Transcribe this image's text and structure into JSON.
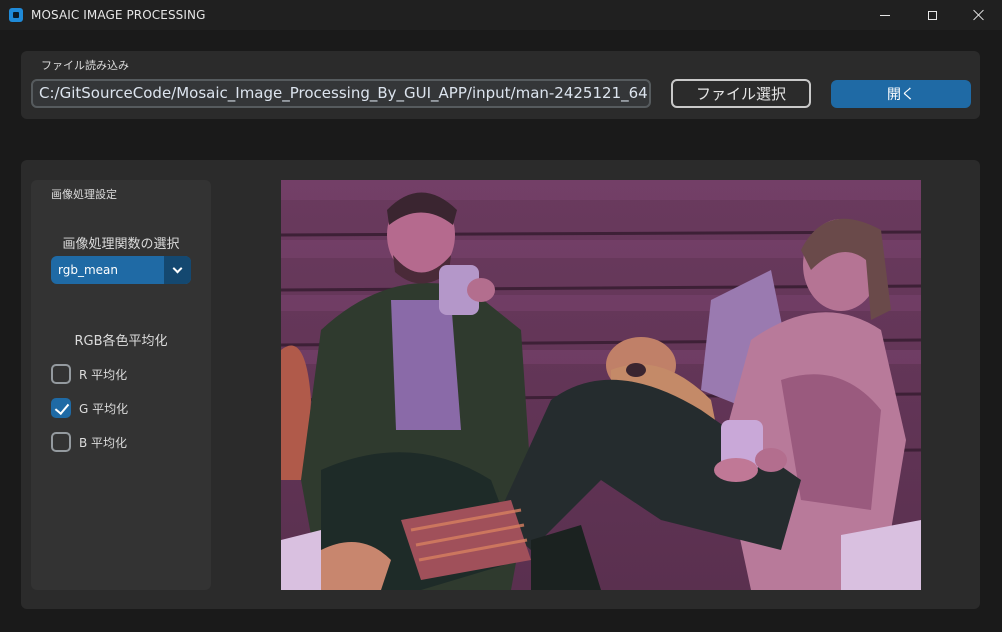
{
  "window": {
    "title": "MOSAIC IMAGE PROCESSING"
  },
  "file_section": {
    "label": "ファイル読み込み",
    "path_value": "C:/GitSourceCode/Mosaic_Image_Processing_By_GUI_APP/input/man-2425121_64",
    "select_button": "ファイル選択",
    "open_button": "開く"
  },
  "settings": {
    "label": "画像処理設定",
    "function_label": "画像処理関数の選択",
    "function_value": "rgb_mean",
    "rgb_label": "RGB各色平均化",
    "checkboxes": [
      {
        "label": "R 平均化",
        "checked": false
      },
      {
        "label": "G 平均化",
        "checked": true
      },
      {
        "label": "B 平均化",
        "checked": false
      }
    ]
  },
  "colors": {
    "accent": "#1f6aa5",
    "background": "#1a1a1a",
    "frame": "#2b2b2b"
  },
  "icons": {
    "app": "app-icon",
    "minimize": "minimize-icon",
    "maximize": "maximize-icon",
    "close": "close-icon",
    "dropdown": "chevron-down-icon"
  }
}
